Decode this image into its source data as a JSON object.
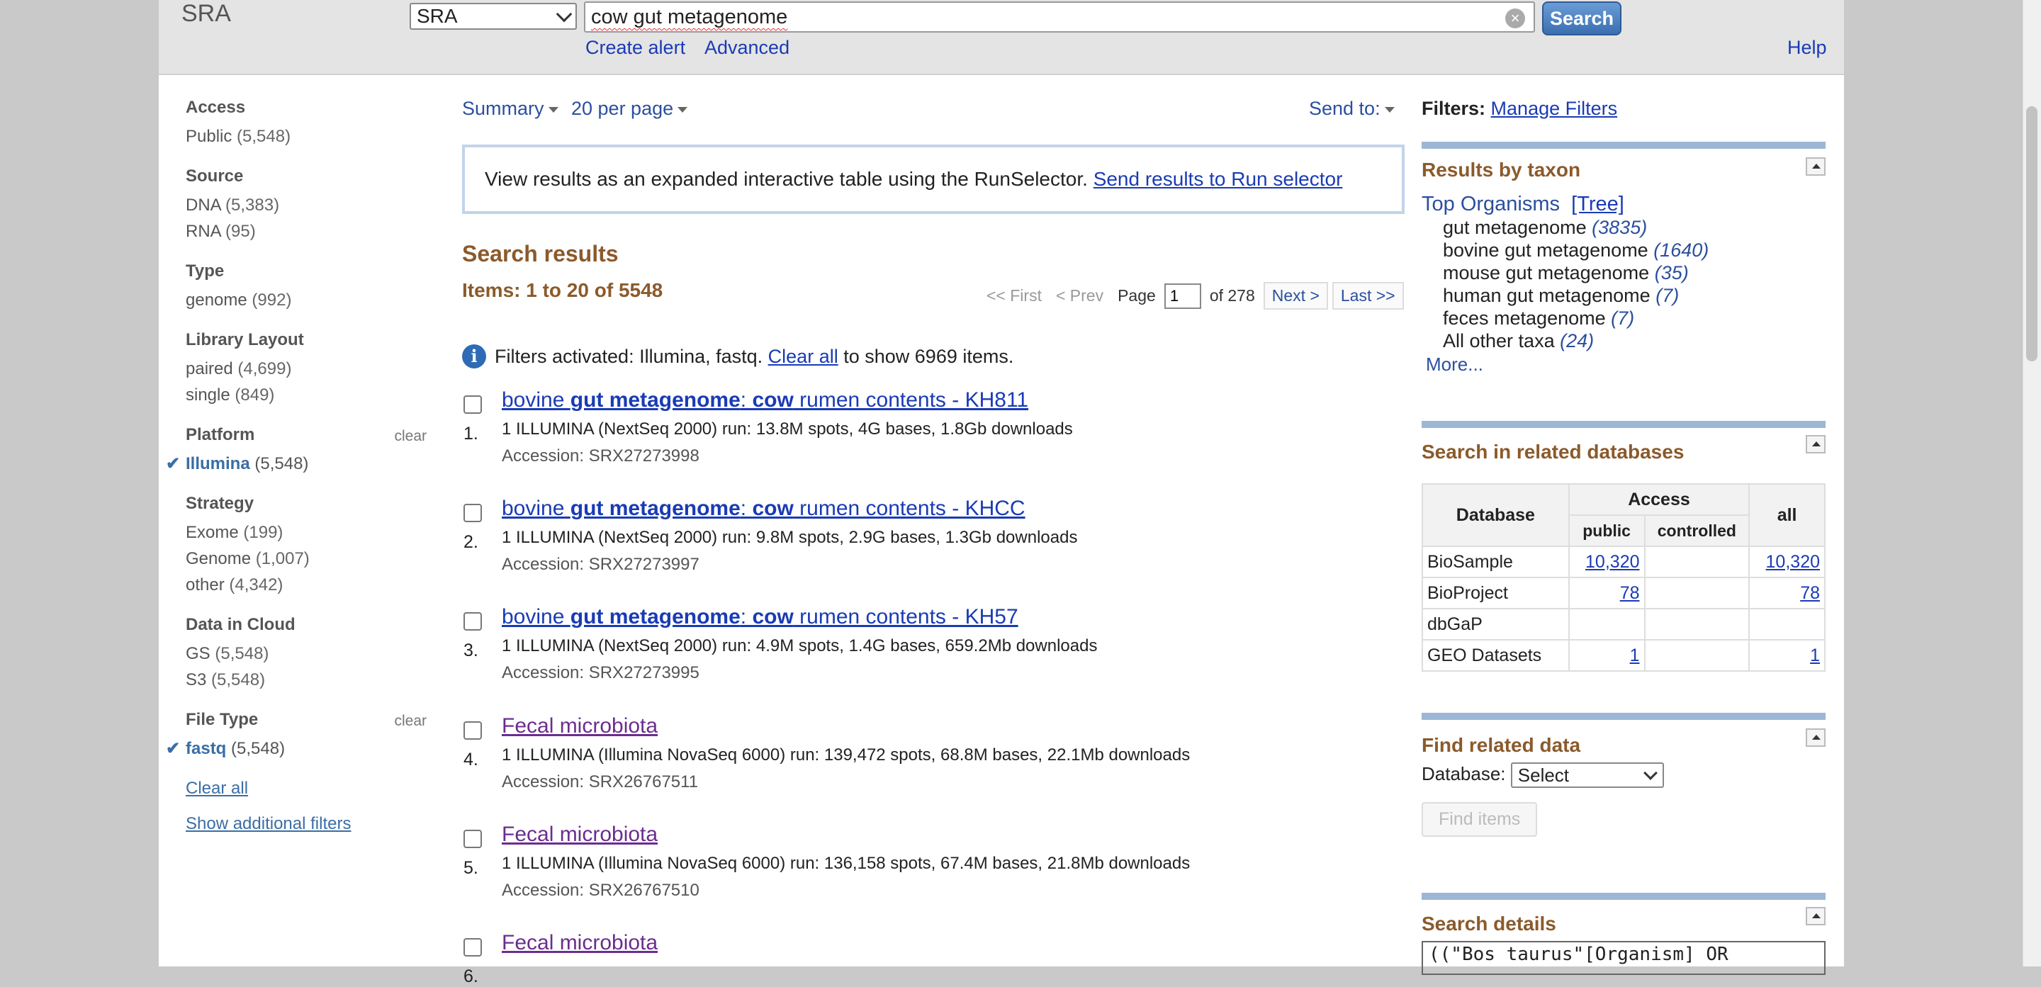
{
  "header": {
    "logo": "SRA",
    "db_select": "SRA",
    "query": "cow gut metagenome",
    "search_label": "Search",
    "create_alert": "Create alert",
    "advanced": "Advanced",
    "help": "Help"
  },
  "facets": [
    {
      "title": "Access",
      "items": [
        {
          "label": "Public",
          "count": "(5,548)"
        }
      ]
    },
    {
      "title": "Source",
      "items": [
        {
          "label": "DNA",
          "count": "(5,383)"
        },
        {
          "label": "RNA",
          "count": "(95)"
        }
      ]
    },
    {
      "title": "Type",
      "items": [
        {
          "label": "genome",
          "count": "(992)"
        }
      ]
    },
    {
      "title": "Library Layout",
      "items": [
        {
          "label": "paired",
          "count": "(4,699)"
        },
        {
          "label": "single",
          "count": "(849)"
        }
      ]
    },
    {
      "title": "Platform",
      "clear": "clear",
      "items": [
        {
          "label": "Illumina",
          "count": "(5,548)",
          "selected": true
        }
      ]
    },
    {
      "title": "Strategy",
      "items": [
        {
          "label": "Exome",
          "count": "(199)"
        },
        {
          "label": "Genome",
          "count": "(1,007)"
        },
        {
          "label": "other",
          "count": "(4,342)"
        }
      ]
    },
    {
      "title": "Data in Cloud",
      "items": [
        {
          "label": "GS",
          "count": "(5,548)"
        },
        {
          "label": "S3",
          "count": "(5,548)"
        }
      ]
    },
    {
      "title": "File Type",
      "clear": "clear",
      "items": [
        {
          "label": "fastq",
          "count": "(5,548)",
          "selected": true
        }
      ]
    }
  ],
  "facet_links": {
    "clear_all": "Clear all",
    "show_additional": "Show additional filters"
  },
  "display": {
    "summary": "Summary",
    "per_page": "20 per page",
    "send_to": "Send to:"
  },
  "runselector": {
    "text": "View results as an expanded interactive table using the RunSelector.",
    "link": "Send results to Run selector"
  },
  "results_header": {
    "title": "Search results",
    "items": "Items: 1 to 20 of 5548",
    "first": "<< First",
    "prev": "< Prev",
    "page_label": "Page",
    "page_value": "1",
    "of": "of 278",
    "next": "Next >",
    "last": "Last >>"
  },
  "filters_activated": {
    "text": "Filters activated: Illumina, fastq.",
    "clear": "Clear all",
    "suffix": "to show 6969 items."
  },
  "results": [
    {
      "num": "1.",
      "pre": "bovine ",
      "b1": "gut metagenome",
      "mid": ": ",
      "b2": "cow",
      "post": " rumen contents - KH811",
      "desc": "1 ILLUMINA (NextSeq 2000) run: 13.8M spots, 4G bases, 1.8Gb downloads",
      "acc": "Accession: SRX27273998"
    },
    {
      "num": "2.",
      "pre": "bovine ",
      "b1": "gut metagenome",
      "mid": ": ",
      "b2": "cow",
      "post": " rumen contents - KHCC",
      "desc": "1 ILLUMINA (NextSeq 2000) run: 9.8M spots, 2.9G bases, 1.3Gb downloads",
      "acc": "Accession: SRX27273997"
    },
    {
      "num": "3.",
      "pre": "bovine ",
      "b1": "gut metagenome",
      "mid": ": ",
      "b2": "cow",
      "post": " rumen contents - KH57",
      "desc": "1 ILLUMINA (NextSeq 2000) run: 4.9M spots, 1.4G bases, 659.2Mb downloads",
      "acc": "Accession: SRX27273995"
    },
    {
      "num": "4.",
      "title": "Fecal microbiota",
      "desc": "1 ILLUMINA (Illumina NovaSeq 6000) run: 139,472 spots, 68.8M bases, 22.1Mb downloads",
      "acc": "Accession: SRX26767511"
    },
    {
      "num": "5.",
      "title": "Fecal microbiota",
      "desc": "1 ILLUMINA (Illumina NovaSeq 6000) run: 136,158 spots, 67.4M bases, 21.8Mb downloads",
      "acc": "Accession: SRX26767510"
    },
    {
      "num": "6.",
      "title": "Fecal microbiota"
    }
  ],
  "right": {
    "filters_label": "Filters:",
    "manage_filters": "Manage Filters",
    "taxon_title": "Results by taxon",
    "top_organisms": "Top Organisms",
    "tree": "[Tree]",
    "taxa": [
      {
        "name": "gut metagenome",
        "count": "(3835)"
      },
      {
        "name": "bovine gut metagenome",
        "count": "(1640)"
      },
      {
        "name": "mouse gut metagenome",
        "count": "(35)"
      },
      {
        "name": "human gut metagenome",
        "count": "(7)"
      },
      {
        "name": "feces metagenome",
        "count": "(7)"
      },
      {
        "name": "All other taxa",
        "count": "(24)"
      }
    ],
    "more": "More...",
    "related_title": "Search in related databases",
    "table": {
      "h_database": "Database",
      "h_access": "Access",
      "h_public": "public",
      "h_controlled": "controlled",
      "h_all": "all",
      "rows": [
        {
          "db": "BioSample",
          "public": "10,320",
          "controlled": "",
          "all": "10,320"
        },
        {
          "db": "BioProject",
          "public": "78",
          "controlled": "",
          "all": "78"
        },
        {
          "db": "dbGaP",
          "public": "",
          "controlled": "",
          "all": ""
        },
        {
          "db": "GEO Datasets",
          "public": "1",
          "controlled": "",
          "all": "1"
        }
      ]
    },
    "find_title": "Find related data",
    "database_label": "Database:",
    "database_select": "Select",
    "find_items": "Find items",
    "details_title": "Search details",
    "details_text": "((\"Bos taurus\"[Organism] OR"
  }
}
